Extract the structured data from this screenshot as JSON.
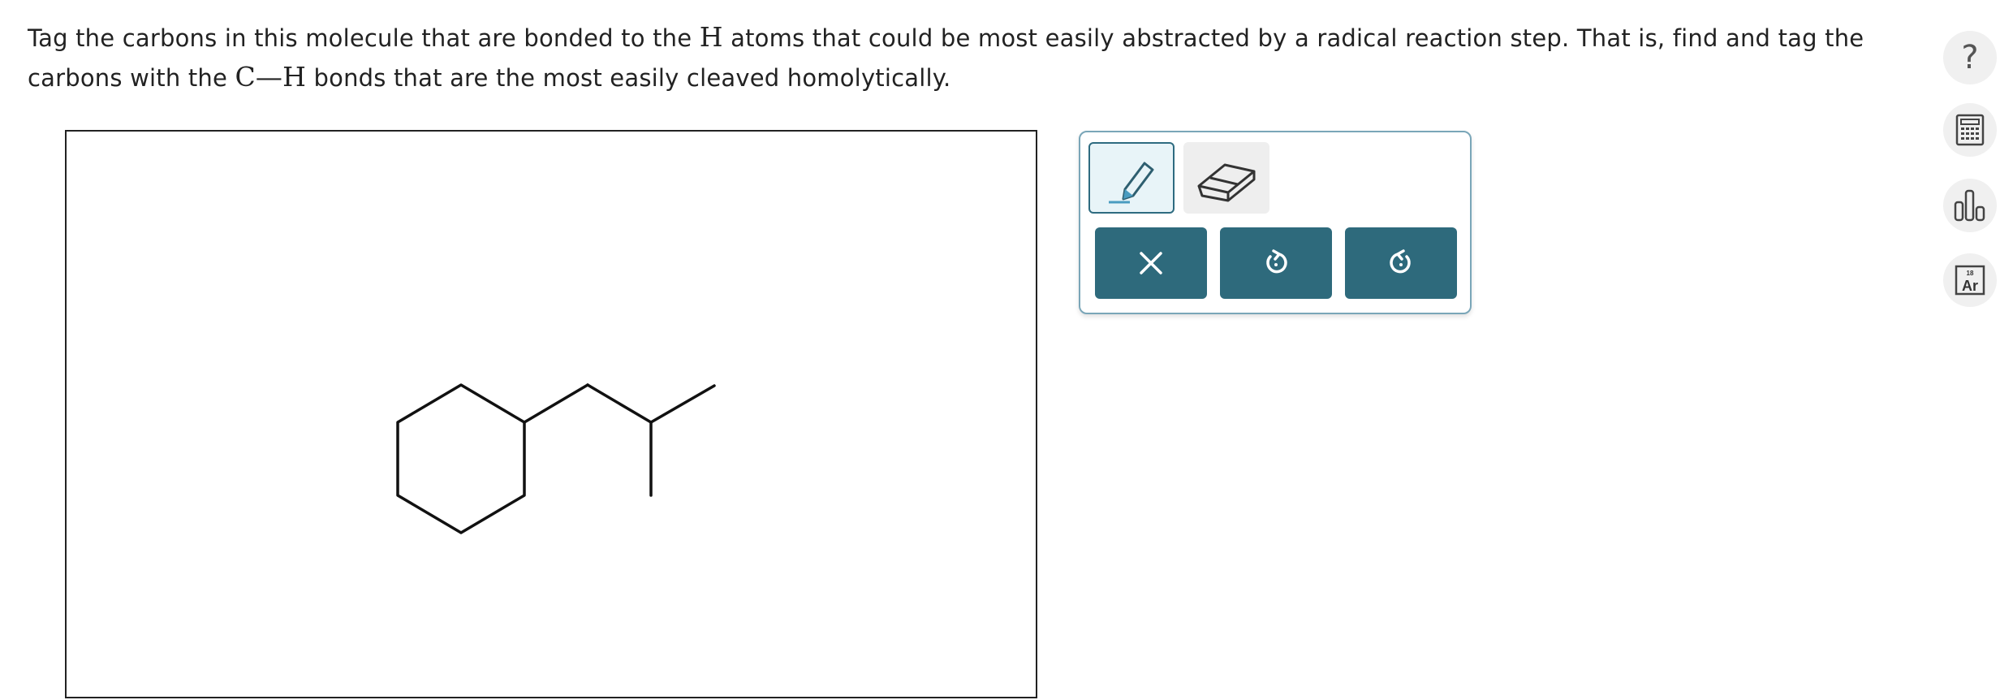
{
  "question": {
    "text_before_H": "Tag the carbons in this molecule that are bonded to the ",
    "H_symbol": "H",
    "text_after_H": " atoms that could be most easily abstracted by a radical reaction step. That is, find and tag the carbons with the ",
    "bond_C": "C",
    "bond_dash": "—",
    "bond_H": "H",
    "text_end": " bonds that are the most easily cleaved homolytically."
  },
  "toolbar": {
    "tools": [
      {
        "name": "pencil-tool",
        "icon": "pencil-icon",
        "selected": true
      },
      {
        "name": "eraser-tool",
        "icon": "eraser-icon",
        "selected": false
      }
    ],
    "actions": [
      {
        "name": "clear-button",
        "icon": "close-icon"
      },
      {
        "name": "undo-button",
        "icon": "undo-icon"
      },
      {
        "name": "redo-button",
        "icon": "redo-icon"
      }
    ]
  },
  "sidebar": {
    "help_label": "?",
    "calculator_icon": "calculator-icon",
    "chart_icon": "bar-chart-icon",
    "periodic_table": {
      "number": "18",
      "symbol": "Ar"
    }
  },
  "molecule": {
    "name": "isobutylcyclohexane skeletal structure",
    "bond_color": "#111111"
  },
  "colors": {
    "accent": "#2e6a7c",
    "toolbar_border": "#7aa6b8",
    "pencil_bg": "#e8f4f8"
  }
}
